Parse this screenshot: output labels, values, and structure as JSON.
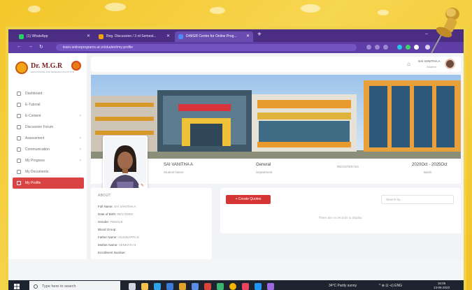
{
  "browser": {
    "tabs": [
      {
        "label": "(1) WhatsApp",
        "color": "#25d366",
        "active": false
      },
      {
        "label": "Reg. Discussion / 3 rd Semest...",
        "color": "#f1a20c",
        "active": false
      },
      {
        "label": "DrMGR Centre for Online Prog...",
        "color": "#4c8bf5",
        "active": true
      }
    ],
    "new_tab": "+",
    "url": "learn.onlineprograms.ac.in/student/my-profile",
    "window_controls": [
      "–",
      "□",
      "✕"
    ]
  },
  "sidebar": {
    "logo_text": "Dr. M.G.R",
    "logo_sub": "EDUCATIONAL AND RESEARCH INSTITUTE",
    "items": [
      {
        "label": "Dashboard",
        "icon": "dashboard-icon",
        "chevron": ""
      },
      {
        "label": "E-Tutorial",
        "icon": "tutorial-icon",
        "chevron": ""
      },
      {
        "label": "E-Content",
        "icon": "content-icon",
        "chevron": "›"
      },
      {
        "label": "Discussion Forum",
        "icon": "forum-icon",
        "chevron": ""
      },
      {
        "label": "Assessment",
        "icon": "assessment-icon",
        "chevron": "›"
      },
      {
        "label": "Communication",
        "icon": "communication-icon",
        "chevron": "›"
      },
      {
        "label": "My Progress",
        "icon": "progress-icon",
        "chevron": "›"
      },
      {
        "label": "My Documents",
        "icon": "documents-icon",
        "chevron": ""
      },
      {
        "label": "My Profile",
        "icon": "profile-icon",
        "chevron": "",
        "active": true
      }
    ]
  },
  "header": {
    "user_name": "SAI VANITHA A",
    "user_role": "Student"
  },
  "profile": {
    "fields": [
      {
        "value": "SAI VANITHA A",
        "label": "Student Name"
      },
      {
        "value": "General",
        "label": "Department"
      },
      {
        "value": "",
        "label": "REGISTER NO"
      },
      {
        "value": "2020Oct - 2025Oct",
        "label": "Batch"
      }
    ]
  },
  "about": {
    "title": "ABOUT",
    "rows": [
      {
        "label": "Full Name:",
        "value": "SAI VANITHA A"
      },
      {
        "label": "Date of Birth:",
        "value": "06/17/2002"
      },
      {
        "label": "Gender:",
        "value": "FEMALE"
      },
      {
        "label": "Blood Group:",
        "value": ""
      },
      {
        "label": "Father Name:",
        "value": "ANJANAPPA K"
      },
      {
        "label": "Mother Name:",
        "value": "VENKATA N"
      },
      {
        "label": "Enrollment Number:",
        "value": ""
      }
    ]
  },
  "quotes": {
    "create_label": "+ Create Quotes",
    "search_placeholder": "Search by...",
    "empty_text": "There are no records to display."
  },
  "taskbar": {
    "search_placeholder": "Type here to search",
    "weather": "34°C  Partly sunny",
    "tray": "^  ⊕  ⊡  ⊲)  ENG",
    "time": "15:05",
    "date": "13-06-2023"
  },
  "colors": {
    "browser_tab_bg": "#4b2d84",
    "accent_red": "#d94343",
    "frame_yellow": "#f0d34a"
  }
}
